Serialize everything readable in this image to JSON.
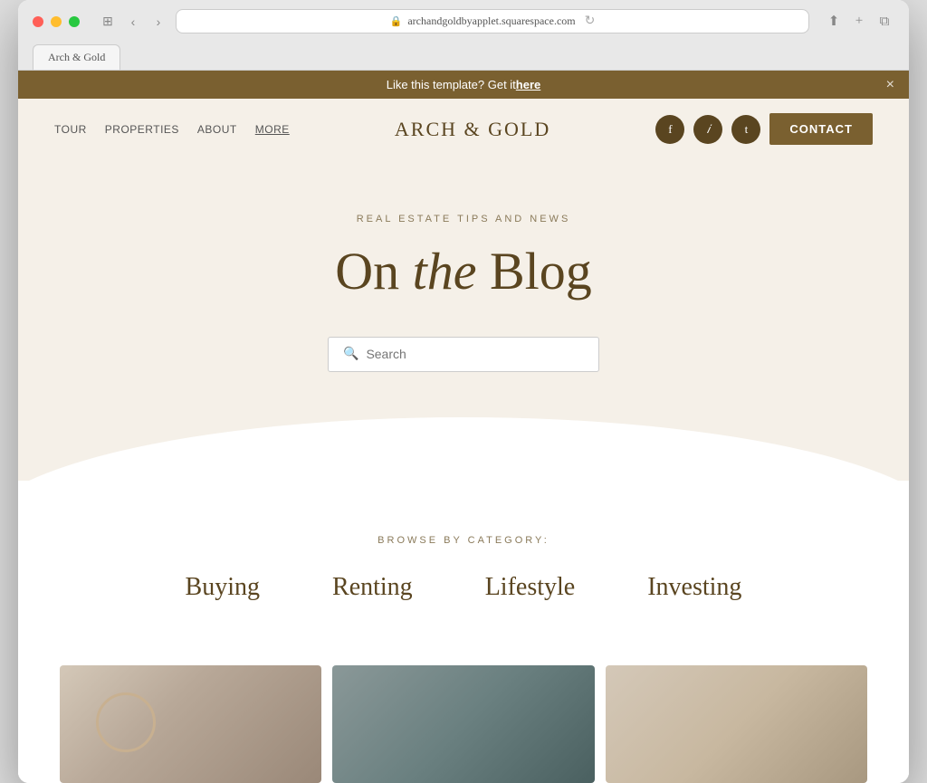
{
  "browser": {
    "url": "archandgoldbyapplet.squarespace.com",
    "tab_label": "Arch & Gold"
  },
  "announcement": {
    "text": "Like this template? Get it ",
    "link_text": "here",
    "close_label": "×"
  },
  "nav": {
    "links": [
      "TOUR",
      "PROPERTIES",
      "ABOUT",
      "MORE"
    ],
    "logo": "ARCH & GOLD",
    "contact_label": "CONTACT",
    "social": [
      "f",
      "i",
      "t"
    ]
  },
  "hero": {
    "subtitle": "REAL ESTATE TIPS AND NEWS",
    "title_plain1": "On ",
    "title_italic": "the",
    "title_plain2": " Blog",
    "search_placeholder": "Search"
  },
  "categories": {
    "browse_label": "BROWSE BY CATEGORY:",
    "items": [
      "Buying",
      "Renting",
      "Lifestyle",
      "Investing"
    ]
  },
  "colors": {
    "brown_dark": "#5a4520",
    "brown_medium": "#7a6030",
    "bg_cream": "#f5f0e8",
    "text_muted": "#8a7a5a"
  }
}
